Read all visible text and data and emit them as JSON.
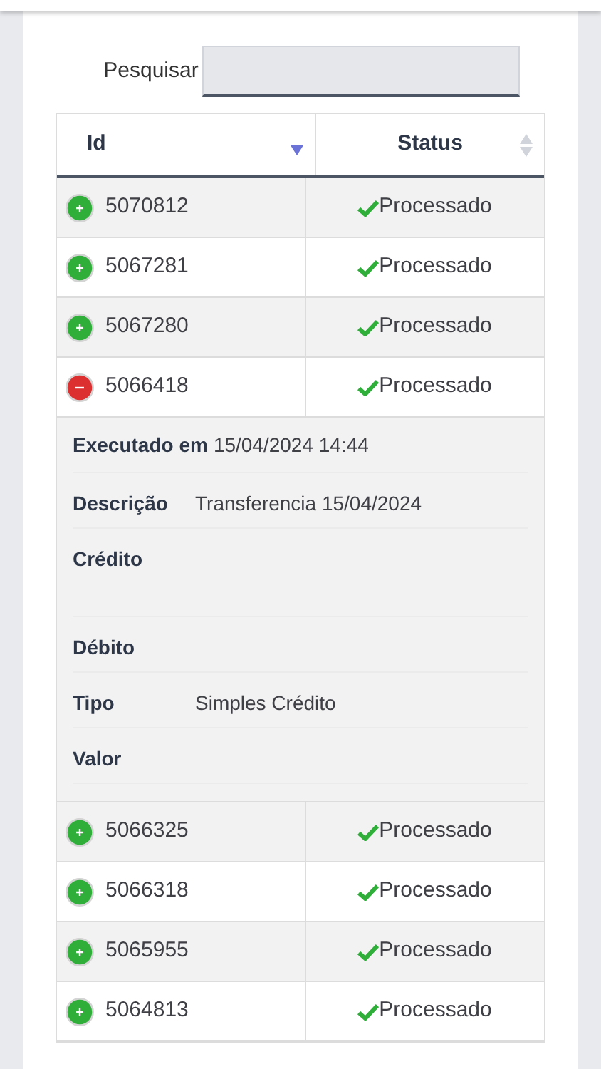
{
  "search": {
    "label": "Pesquisar"
  },
  "table": {
    "columns": [
      {
        "label": "Id",
        "sorted": true
      },
      {
        "label": "Status",
        "sorted": false
      }
    ],
    "rows": [
      {
        "id": "5070812",
        "status": "Processado",
        "expanded": false
      },
      {
        "id": "5067281",
        "status": "Processado",
        "expanded": false
      },
      {
        "id": "5067280",
        "status": "Processado",
        "expanded": false
      },
      {
        "id": "5066418",
        "status": "Processado",
        "expanded": true,
        "details": [
          {
            "kind": "inline",
            "label": "Executado em",
            "value": "15/04/2024 14:44"
          },
          {
            "kind": "field",
            "label": "Descrição",
            "value": "Transferencia 15/04/2024"
          },
          {
            "kind": "tall",
            "label": "Crédito"
          },
          {
            "kind": "field",
            "label": "Débito"
          },
          {
            "kind": "field",
            "label": "Tipo",
            "value": "Simples Crédito"
          },
          {
            "kind": "field",
            "label": "Valor"
          }
        ]
      },
      {
        "id": "5066325",
        "status": "Processado",
        "expanded": false
      },
      {
        "id": "5066318",
        "status": "Processado",
        "expanded": false
      },
      {
        "id": "5065955",
        "status": "Processado",
        "expanded": false
      },
      {
        "id": "5064813",
        "status": "Processado",
        "expanded": false
      }
    ]
  }
}
